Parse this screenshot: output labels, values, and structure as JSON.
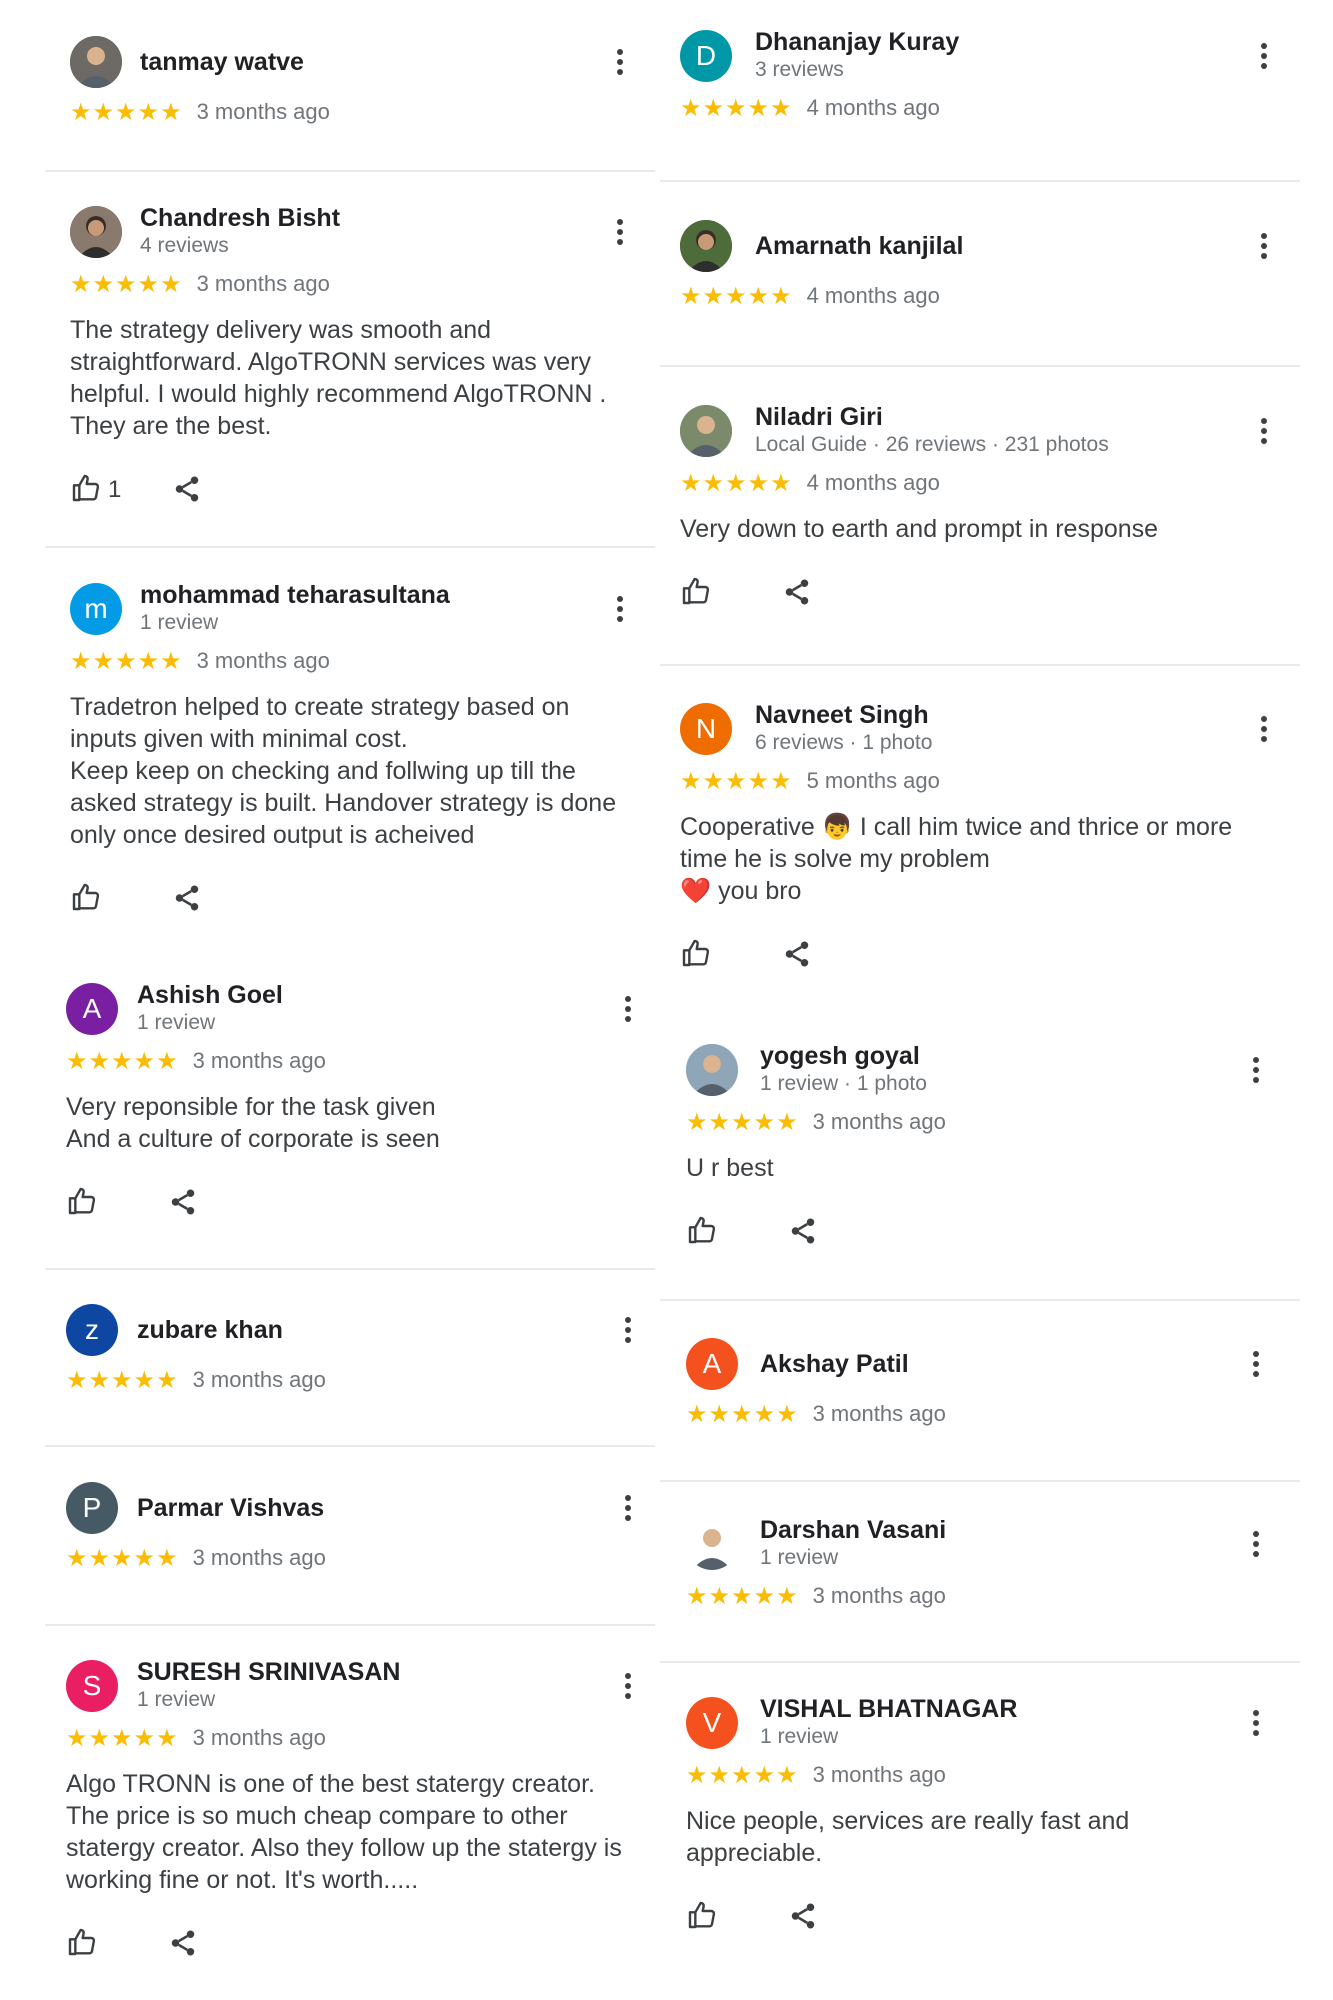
{
  "left": [
    {
      "name": "tanmay watve",
      "sub": "",
      "stars": "★★★★★",
      "time": "3 months ago",
      "text": [],
      "avatar_letter": "",
      "avatar_color": "#6d6a66",
      "likes": "",
      "show_actions": false
    },
    {
      "name": "Chandresh Bisht",
      "sub": "4 reviews",
      "stars": "★★★★★",
      "time": "3 months ago",
      "text": [
        "The strategy delivery was smooth and",
        "straightforward. AlgoTRONN services was very",
        "helpful. I would highly recommend AlgoTRONN .",
        "They are the best."
      ],
      "avatar_letter": "",
      "avatar_color": "#8a7a6e",
      "likes": "1",
      "show_actions": true
    },
    {
      "name": "mohammad teharasultana",
      "sub": "1 review",
      "stars": "★★★★★",
      "time": "3 months ago",
      "text": [
        "Tradetron helped to create strategy based on",
        "inputs given with minimal cost.",
        "Keep keep on checking and follwing up till the",
        "asked strategy is built. Handover strategy is done",
        "only once desired output is acheived"
      ],
      "avatar_letter": "m",
      "avatar_color": "#039be5",
      "likes": "",
      "show_actions": true
    },
    {
      "name": "Ashish Goel",
      "sub": "1 review",
      "stars": "★★★★★",
      "time": "3 months ago",
      "text": [
        "Very reponsible for the task given",
        "And a culture of corporate is seen"
      ],
      "avatar_letter": "A",
      "avatar_color": "#7b1fa2",
      "likes": "",
      "show_actions": true
    },
    {
      "name": "zubare khan",
      "sub": "",
      "stars": "★★★★★",
      "time": "3 months ago",
      "text": [],
      "avatar_letter": "z",
      "avatar_color": "#0d47a1",
      "likes": "",
      "show_actions": false
    },
    {
      "name": "Parmar Vishvas",
      "sub": "",
      "stars": "★★★★★",
      "time": "3 months ago",
      "text": [],
      "avatar_letter": "P",
      "avatar_color": "#455a64",
      "likes": "",
      "show_actions": false
    },
    {
      "name": "SURESH SRINIVASAN",
      "sub": "1 review",
      "stars": "★★★★★",
      "time": "3 months ago",
      "text": [
        "Algo TRONN is one of the best statergy creator.",
        "The price is so much cheap compare to other",
        "statergy creator. Also they follow up the statergy is",
        "working fine or not. It's worth....."
      ],
      "avatar_letter": "S",
      "avatar_color": "#e91e63",
      "likes": "",
      "show_actions": true
    }
  ],
  "right": [
    {
      "name": "Dhananjay Kuray",
      "sub": "3 reviews",
      "stars": "★★★★★",
      "time": "4 months ago",
      "text": [],
      "avatar_letter": "D",
      "avatar_color": "#0097a7",
      "likes": "",
      "show_actions": false
    },
    {
      "name": "Amarnath kanjilal",
      "sub": "",
      "stars": "★★★★★",
      "time": "4 months ago",
      "text": [],
      "avatar_letter": "",
      "avatar_color": "#4e6b3a",
      "likes": "",
      "show_actions": false
    },
    {
      "name": "Niladri Giri",
      "sub": "Local Guide · 26 reviews · 231 photos",
      "stars": "★★★★★",
      "time": "4 months ago",
      "text": [
        "Very down to earth and prompt in response"
      ],
      "avatar_letter": "",
      "avatar_color": "#7c8a6c",
      "likes": "",
      "show_actions": true
    },
    {
      "name": "Navneet Singh",
      "sub": "6 reviews · 1 photo",
      "stars": "★★★★★",
      "time": "5 months ago",
      "text": [
        "Cooperative 👦 I call him twice and thrice or more",
        "time he is solve my problem",
        "❤️ you bro"
      ],
      "avatar_letter": "N",
      "avatar_color": "#ef6c00",
      "likes": "",
      "show_actions": true
    },
    {
      "name": "yogesh goyal",
      "sub": "1 review · 1 photo",
      "stars": "★★★★★",
      "time": "3 months ago",
      "text": [
        "U r best"
      ],
      "avatar_letter": "",
      "avatar_color": "#8fa6b8",
      "likes": "",
      "show_actions": true
    },
    {
      "name": "Akshay Patil",
      "sub": "",
      "stars": "★★★★★",
      "time": "3 months ago",
      "text": [],
      "avatar_letter": "A",
      "avatar_color": "#f4511e",
      "likes": "",
      "show_actions": false
    },
    {
      "name": "Darshan Vasani",
      "sub": "1 review",
      "stars": "★★★★★",
      "time": "3 months ago",
      "text": [],
      "avatar_letter": "",
      "avatar_color": "#ffffff",
      "likes": "",
      "show_actions": false
    },
    {
      "name": "VISHAL BHATNAGAR",
      "sub": "1 review",
      "stars": "★★★★★",
      "time": "3 months ago",
      "text": [
        "Nice people, services are really fast and",
        "appreciable."
      ],
      "avatar_letter": "V",
      "avatar_color": "#f4511e",
      "likes": "",
      "show_actions": true
    }
  ],
  "icons": {
    "like": "thumbs-up-icon",
    "share": "share-icon",
    "menu": "more-vert-icon"
  },
  "colors": {
    "star": "#fbbc04",
    "divider": "#e8eaed",
    "secondary_text": "#70757a"
  }
}
